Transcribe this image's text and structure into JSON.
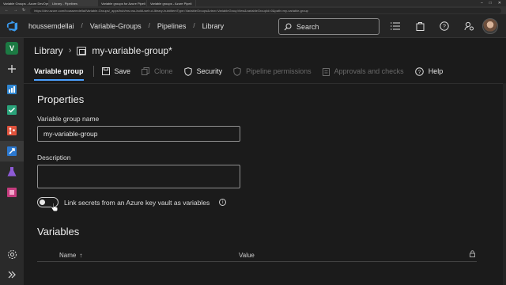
{
  "browser": {
    "tabs": [
      {
        "label": "Variable Groups - Azure DevOps",
        "active": false
      },
      {
        "label": "Library - Pipelines",
        "active": true
      },
      {
        "label": "Variable groups for Azure Pipeli",
        "active": false
      },
      {
        "label": "Variable groups - Azure Pipeli",
        "active": false
      }
    ],
    "url": "https://dev.azure.com/houssemdellai/Variable-Groups/_apps/hub/ms.vss-build-web.ci-library-hub#itemType=VariableGroups&view=VariableGroupView&variableGroupId=0&path=my-variable-group"
  },
  "topbar": {
    "breadcrumb": [
      "houssemdellai",
      "Variable-Groups",
      "Pipelines",
      "Library"
    ],
    "search_placeholder": "Search",
    "icons": [
      "list-icon",
      "bag-icon",
      "help-icon",
      "user-settings-icon"
    ]
  },
  "leftnav": {
    "project_initial": "V",
    "items": [
      "add-icon",
      "overview-icon",
      "boards-icon",
      "repos-icon",
      "pipelines-icon",
      "test-plans-icon",
      "artifacts-icon"
    ],
    "bottom": [
      "settings-icon",
      "collapse-icon"
    ]
  },
  "page": {
    "library_label": "Library",
    "group_title": "my-variable-group*"
  },
  "toolbar": {
    "tab_label": "Variable group",
    "save_label": "Save",
    "clone_label": "Clone",
    "security_label": "Security",
    "pipeline_permissions_label": "Pipeline permissions",
    "approvals_label": "Approvals and checks",
    "help_label": "Help"
  },
  "properties": {
    "title": "Properties",
    "name_label": "Variable group name",
    "name_value": "my-variable-group",
    "description_label": "Description",
    "description_value": "",
    "link_secrets_label": "Link secrets from an Azure key vault as variables",
    "link_secrets_on": false
  },
  "variables": {
    "title": "Variables",
    "col_name": "Name",
    "col_value": "Value"
  },
  "colors": {
    "accent": "#4ca0ff",
    "project_badge": "#1c7a43"
  }
}
